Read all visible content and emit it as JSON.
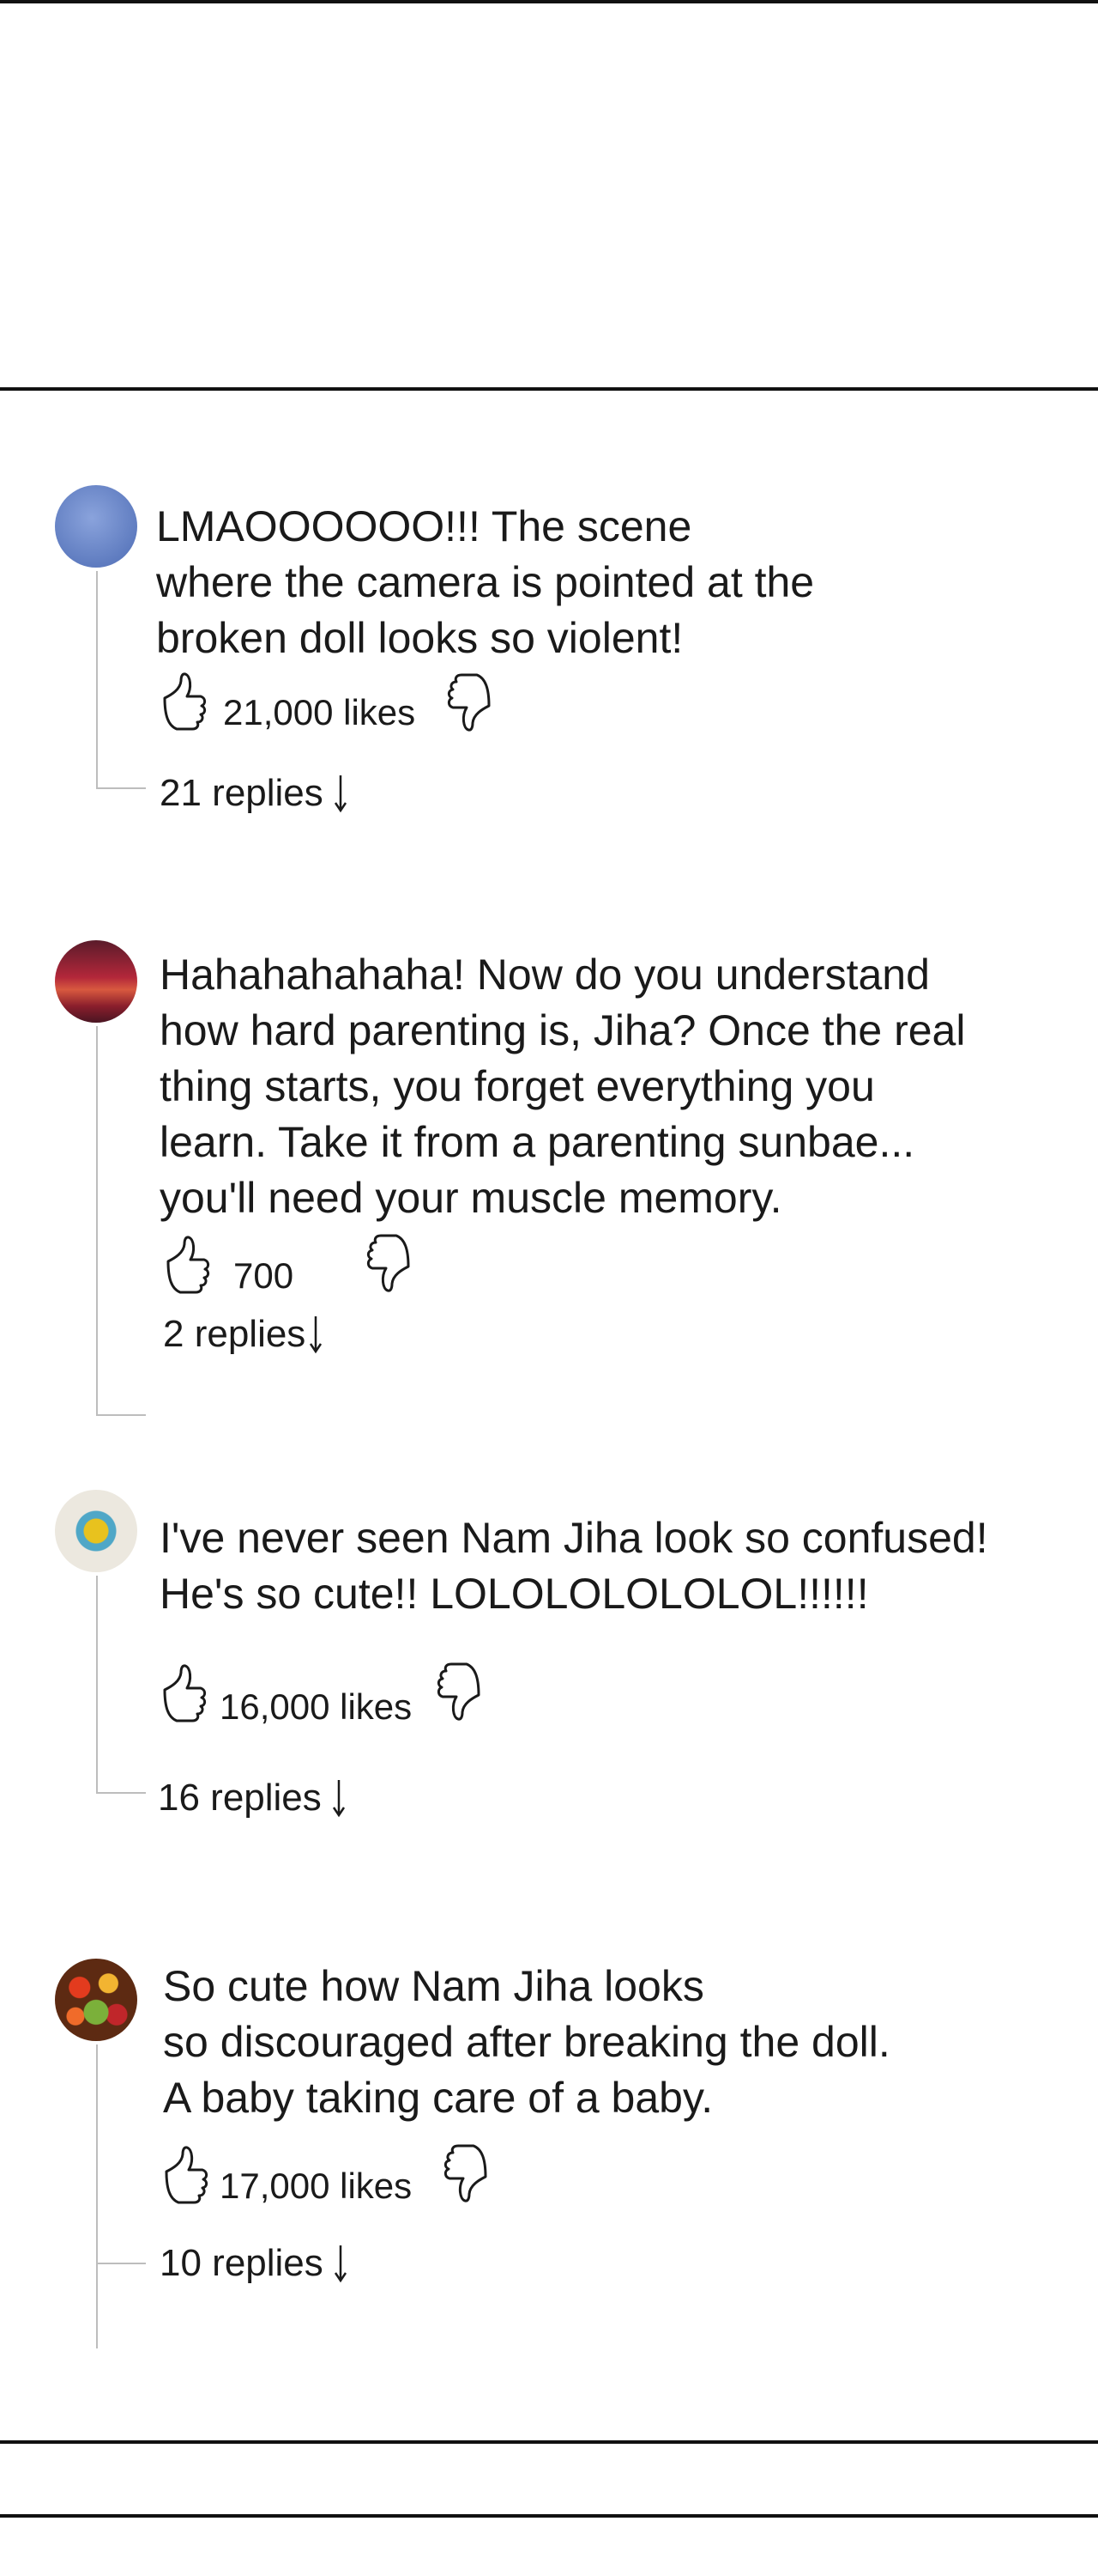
{
  "comments": [
    {
      "text": "LMAOOOOOO!!! The scene\nwhere the camera is pointed at the\nbroken doll looks so violent!",
      "likes": "21,000 likes",
      "replies": "21 replies",
      "avatar_color": "#6b86c8",
      "avatar_icon": "blue-circle-avatar"
    },
    {
      "text": "Hahahahahaha! Now do you understand\nhow hard parenting is, Jiha? Once the real\nthing starts, you forget everything you\nlearn. Take it from a parenting sunbae...\nyou'll need your muscle memory.",
      "likes": "700",
      "replies": "2 replies",
      "avatar_color": "#8a1f2e",
      "avatar_icon": "sunset-avatar"
    },
    {
      "text": "I've never seen Nam Jiha look so confused!\nHe's so cute!! LOLOLOLOLOLOL!!!!!!",
      "likes": "16,000 likes",
      "replies": "16 replies",
      "avatar_color": "#ece8df",
      "avatar_icon": "target-avatar"
    },
    {
      "text": "So cute how Nam Jiha looks\nso discouraged after breaking the doll.\nA baby taking care of a baby.",
      "likes": "17,000 likes",
      "replies": "10 replies",
      "avatar_color": "#7a3a1c",
      "avatar_icon": "fruit-avatar"
    }
  ]
}
